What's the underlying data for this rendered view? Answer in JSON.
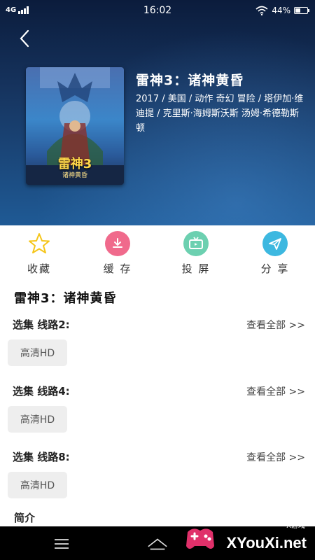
{
  "status_bar": {
    "network": "4G",
    "time": "16:02",
    "battery": "44%"
  },
  "movie": {
    "title": "雷神3：诸神黄昏",
    "meta": "2017 / 美国 / 动作 奇幻 冒险 / 塔伊加·维迪提 / 克里斯·海姆斯沃斯 汤姆·希德勒斯顿",
    "poster_text": "雷神3",
    "poster_subtext": "诸神黄昏"
  },
  "actions": [
    {
      "label": "收藏",
      "icon": "star-icon",
      "color": "#f5c518"
    },
    {
      "label": "缓 存",
      "icon": "download-icon",
      "color": "#f06a8c"
    },
    {
      "label": "投 屏",
      "icon": "tv-icon",
      "color": "#6cd0b0"
    },
    {
      "label": "分 享",
      "icon": "send-icon",
      "color": "#3db8e0"
    }
  ],
  "episodes": {
    "title": "雷神3：诸神黄昏",
    "routes": [
      {
        "label": "选集  线路2:",
        "see_all": "查看全部 >>",
        "quality": "高清HD"
      },
      {
        "label": "选集  线路4:",
        "see_all": "查看全部 >>",
        "quality": "高清HD"
      },
      {
        "label": "选集  线路8:",
        "see_all": "查看全部 >>",
        "quality": "高清HD"
      }
    ]
  },
  "intro_label": "简介",
  "watermark": {
    "brand": "XYouXi.net",
    "small": "X游戏"
  }
}
